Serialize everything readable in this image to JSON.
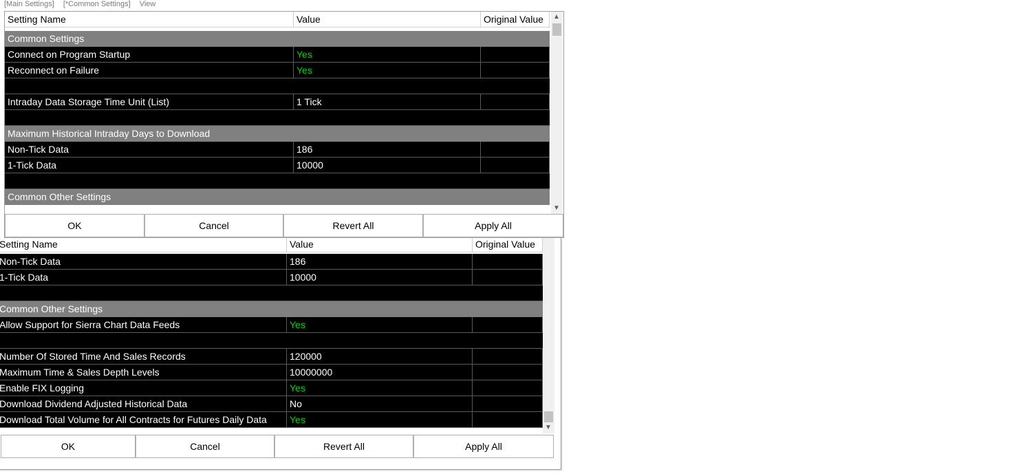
{
  "menu": {
    "items": [
      "[Main Settings]",
      "[*Common Settings]",
      "View"
    ]
  },
  "columns": {
    "name": "Setting Name",
    "value": "Value",
    "original": "Original Value"
  },
  "top_rows": [
    {
      "kind": "section",
      "name": "Common Settings",
      "value": "",
      "yes": false
    },
    {
      "kind": "data",
      "name": "Connect on Program Startup",
      "value": "Yes",
      "yes": true
    },
    {
      "kind": "data",
      "name": "Reconnect on Failure",
      "value": "Yes",
      "yes": true
    },
    {
      "kind": "blank",
      "name": "",
      "value": "",
      "yes": false
    },
    {
      "kind": "data",
      "name": "Intraday Data Storage Time Unit (List)",
      "value": "1 Tick",
      "yes": false
    },
    {
      "kind": "blank",
      "name": "",
      "value": "",
      "yes": false
    },
    {
      "kind": "section",
      "name": "Maximum Historical Intraday Days to Download",
      "value": "",
      "yes": false
    },
    {
      "kind": "data",
      "name": "Non-Tick Data",
      "value": "186",
      "yes": false
    },
    {
      "kind": "data",
      "name": "1-Tick Data",
      "value": "10000",
      "yes": false
    },
    {
      "kind": "blank",
      "name": "",
      "value": "",
      "yes": false
    },
    {
      "kind": "section",
      "name": "Common Other Settings",
      "value": "",
      "yes": false
    },
    {
      "kind": "data",
      "name": "Allow Support for Sierra Chart Data Feeds",
      "value": "Yes",
      "yes": true
    }
  ],
  "bottom_rows": [
    {
      "kind": "data",
      "name": "Non-Tick Data",
      "value": "186",
      "yes": false
    },
    {
      "kind": "data",
      "name": "1-Tick Data",
      "value": "10000",
      "yes": false
    },
    {
      "kind": "blank",
      "name": "",
      "value": "",
      "yes": false
    },
    {
      "kind": "section",
      "name": "Common Other Settings",
      "value": "",
      "yes": false
    },
    {
      "kind": "data",
      "name": "Allow Support for Sierra Chart Data Feeds",
      "value": "Yes",
      "yes": true
    },
    {
      "kind": "blank",
      "name": "",
      "value": "",
      "yes": false
    },
    {
      "kind": "data",
      "name": "Number Of Stored Time And Sales Records",
      "value": "120000",
      "yes": false
    },
    {
      "kind": "data",
      "name": "Maximum Time & Sales Depth Levels",
      "value": "10000000",
      "yes": false
    },
    {
      "kind": "data",
      "name": "Enable FIX Logging",
      "value": "Yes",
      "yes": true
    },
    {
      "kind": "data",
      "name": "Download Dividend Adjusted Historical Data",
      "value": "No",
      "yes": false
    },
    {
      "kind": "data",
      "name": "Download Total Volume for All Contracts for Futures Daily Data",
      "value": "Yes",
      "yes": true
    }
  ],
  "buttons": {
    "ok": "OK",
    "cancel": "Cancel",
    "revert": "Revert All",
    "apply": "Apply All"
  },
  "scroll": {
    "top_position": 0.0,
    "bottom_position": 1.0
  },
  "colors": {
    "yes_text": "#00d000",
    "section_bg": "#808080",
    "row_bg": "#000000"
  }
}
